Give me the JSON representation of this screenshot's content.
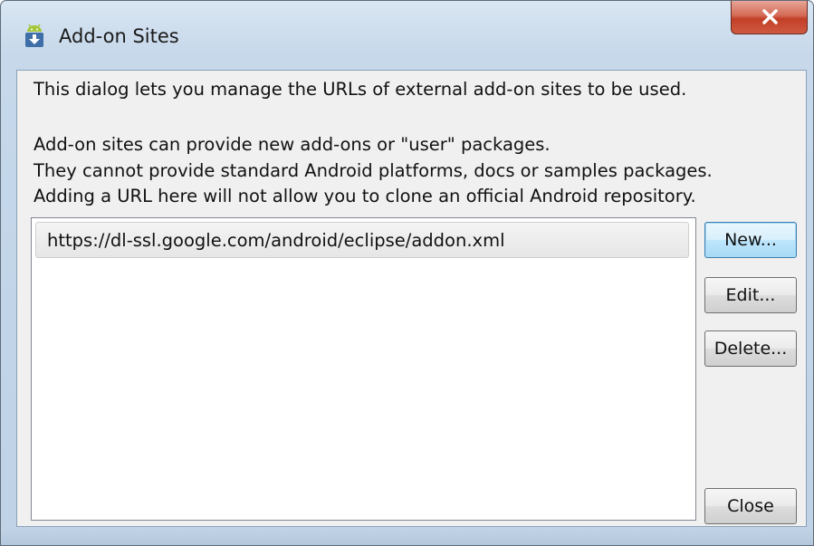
{
  "window": {
    "title": "Add-on Sites",
    "app_icon": "android-download-icon",
    "close_icon": "close-x-icon"
  },
  "dialog": {
    "intro": "This dialog lets you manage the URLs of external add-on sites to be used.",
    "lines": [
      "Add-on sites can provide new add-ons or \"user\" packages.",
      "They cannot provide standard Android platforms, docs or samples packages.",
      "Adding a URL here will not allow you to clone an official Android repository."
    ]
  },
  "sites": [
    "https://dl-ssl.google.com/android/eclipse/addon.xml"
  ],
  "buttons": {
    "new": "New...",
    "edit": "Edit...",
    "delete": "Delete...",
    "close": "Close"
  },
  "colors": {
    "android_green": "#a4c639",
    "close_red": "#c23f27",
    "default_button_border": "#3c7fb1"
  }
}
